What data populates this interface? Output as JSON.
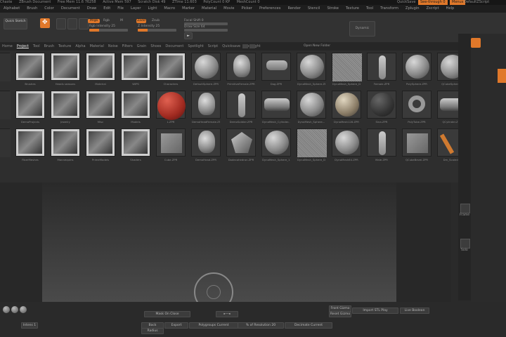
{
  "titlebar": {
    "items": [
      "Chaste",
      "ZBrush Document",
      "Free Mem 11.6 76258",
      "Active Mem 597",
      "Scratch Disk 49",
      "ZTime 11.603",
      "PolyCount 0 KP",
      "MeshCount 0"
    ],
    "quicksave": "QuickSave",
    "see_through": "See-through 0",
    "menus": "Menus",
    "default_script": "DefaultZScript"
  },
  "menubar": [
    "Alphabet",
    "Brush",
    "Color",
    "Document",
    "Draw",
    "Edit",
    "File",
    "Layer",
    "Light",
    "Macro",
    "Marker",
    "Material",
    "Movie",
    "Picker",
    "Preferences",
    "Render",
    "Stencil",
    "Stroke",
    "Texture",
    "Tool",
    "Transform",
    "Zplugin",
    "Zscript",
    "Help"
  ],
  "toolbar": {
    "quick_sketch": "Quick Sketch",
    "mrgb": "Mrgb",
    "rgb": "Rgb",
    "m": "M",
    "zadd": "Zadd",
    "zsub": "Zsub",
    "rgb_intensity": "Rgb Intensity 25",
    "z_intensity": "Z Intensity 25",
    "focal_shift": "Focal Shift 0",
    "draw_size": "Draw Size 64",
    "dynamic": "Dynamic",
    "rgb_level": 0.25,
    "z_level": 0.25
  },
  "lightbox": {
    "tabs": [
      "Home",
      "Project",
      "Tool",
      "Brush",
      "Texture",
      "Alpha",
      "Material",
      "Noise",
      "Filters",
      "Grain",
      "Shoes",
      "Document",
      "Spotlight",
      "Script",
      "Quicksave",
      "Spotlight"
    ],
    "active_tab": "Project",
    "open": "Open",
    "new_folder": "New Folder",
    "row1": [
      "",
      "Brushes",
      "Heads seasons",
      "Material",
      "WIPS",
      "Characters",
      "DefaultSphere.ZPR",
      "PrimitiveFemale.ZPR",
      "Dog.ZPR",
      "DynaMesh_Sphere.ZPR",
      "DynaMesh_Sphere_DetailBo...",
      "Female.ZPR",
      "PolySphere.ZPR",
      "QCubeSphere..."
    ],
    "row2": [
      "",
      "DemoProjects",
      "Jewelry",
      "Misc",
      "Models",
      "L.ZPR",
      "DemoHeadFemale.ZPR",
      "DemoSoldier.ZPR",
      "DynaMesh_Cylinder...",
      "DynaMesh_Sphere...",
      "DynaMesh128.ZPR",
      "Sina.ZPR",
      "PolyTube.ZPR",
      "QCylinder.ZPR"
    ],
    "row3": [
      "",
      "FiberMeshes",
      "Mannequins",
      "PrimeModels",
      "Shaders",
      "Cube.ZPR",
      "DemoHead.ZPR",
      "Dodecahedron.ZPR",
      "DynaMesh_Sphere_1...",
      "DynaMesh_Sphere_DetailBo...",
      "DynaMesh64.ZPR",
      "Male.ZPR",
      "QCubeBevel.ZPR",
      "Dm_Scaled..."
    ]
  },
  "right_shelf": {
    "frame": "Frame",
    "solo": "Solo"
  },
  "bottom": {
    "mask_on_close": "Mask On Close",
    "back": "Back",
    "radius": "Radius",
    "export": "Export",
    "polygroups": "Polygroups Current",
    "of_resolution": "% of Resolution 20",
    "decimate": "Decimate Current",
    "front_gizmo": "Front Gizmo",
    "reset_gizmo": "Reset Gizmo",
    "import_stl": "Import STL Play",
    "live_boolean": "Live Boolean",
    "intens": "Intens 1",
    "zoom_label": "▸—◂"
  }
}
